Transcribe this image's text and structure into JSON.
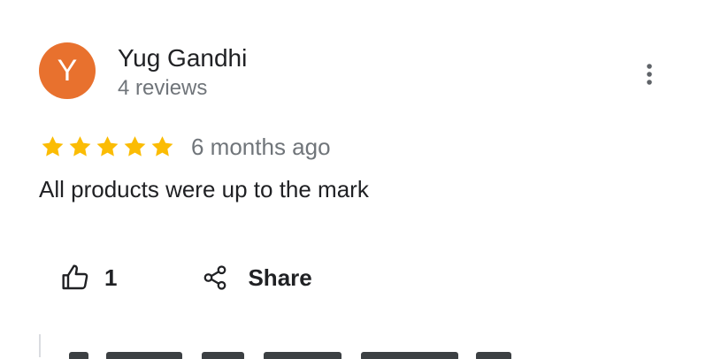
{
  "review": {
    "author": {
      "initial": "Y",
      "name": "Yug Gandhi",
      "review_count": "4 reviews",
      "avatar_color": "#e8712e"
    },
    "rating": 5,
    "time": "6 months ago",
    "text": "All products were up to the mark",
    "like_count": "1",
    "share_label": "Share",
    "star_color": "#fbbc04",
    "icons": {
      "more": "more-vert-icon",
      "like": "thumbs-up-icon",
      "share": "share-icon",
      "star": "star-icon"
    }
  }
}
